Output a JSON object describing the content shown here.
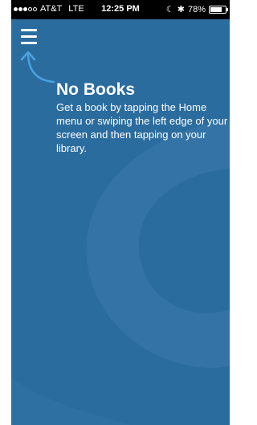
{
  "status_bar": {
    "signal_bars_filled": 3,
    "signal_bars_total": 5,
    "carrier": "AT&T",
    "network": "LTE",
    "time": "12:25 PM",
    "icons": [
      "moon-icon",
      "bluetooth-icon"
    ],
    "battery_percent": "78%",
    "battery_level": 0.78
  },
  "nav": {
    "menu_icon": "hamburger-menu-icon",
    "pointer_icon": "curved-up-arrow-icon"
  },
  "empty_state": {
    "title": "No Books",
    "message": "Get a book by tapping the Home menu or swiping the left edge of your screen and then tapping on your library."
  },
  "colors": {
    "background": "#2b6c9f",
    "swirl": "#3473a6",
    "arrow": "#4aa3e0",
    "text": "#ffffff",
    "status_bar": "#000000"
  }
}
